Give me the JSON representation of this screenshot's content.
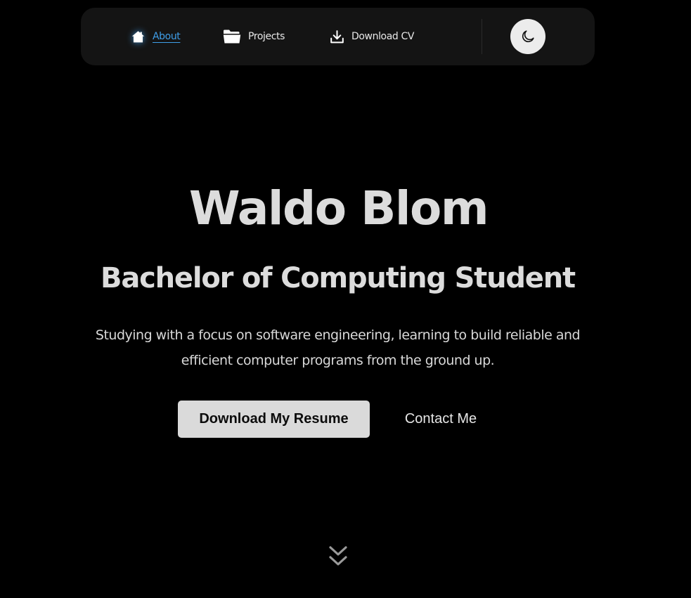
{
  "nav": {
    "items": [
      {
        "label": "About",
        "icon": "home-icon",
        "active": true
      },
      {
        "label": "Projects",
        "icon": "folder-icon",
        "active": false
      },
      {
        "label": "Download CV",
        "icon": "download-icon",
        "active": false
      }
    ],
    "theme_toggle_icon": "moon-icon"
  },
  "hero": {
    "name": "Waldo Blom",
    "subtitle": "Bachelor of Computing Student",
    "description": "Studying with a focus on software engineering, learning to build reliable and efficient computer programs from the ground up.",
    "primary_button": "Download My Resume",
    "secondary_button": "Contact Me",
    "scroll_icon": "double-chevron-down-icon"
  },
  "colors": {
    "background": "#000000",
    "navbar": "#141414",
    "accent": "#3f9ee8",
    "text": "#dcdcdc",
    "button_bg": "#dadada"
  }
}
